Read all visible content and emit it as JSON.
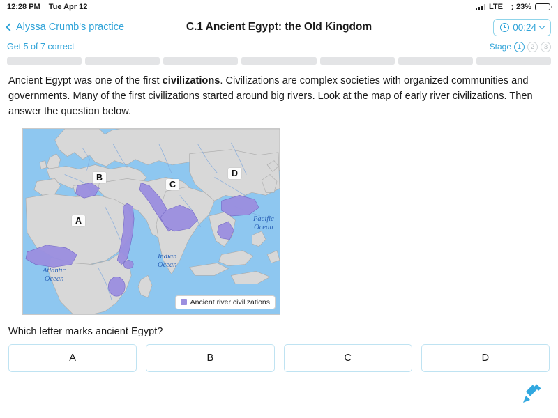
{
  "statusbar": {
    "time": "12:28 PM",
    "date": "Tue Apr 12",
    "network": "LTE",
    "battery_percent": "23%",
    "icons": [
      "signal-bars-icon",
      "moon-icon",
      "battery-icon"
    ]
  },
  "navbar": {
    "back_label": "Alyssa Crumb's practice",
    "back_icon": "chevron-left-icon",
    "title": "C.1 Ancient Egypt: the Old Kingdom",
    "timer": {
      "icon": "clock-icon",
      "value": "00:24",
      "chevron": "chevron-down-icon"
    }
  },
  "progress": {
    "goal_text": "Get 5 of 7 correct",
    "stage_label": "Stage",
    "stages": [
      "1",
      "2",
      "3"
    ],
    "active_stage": "1",
    "segments": 7,
    "filled_segments": 0
  },
  "passage": {
    "part1": "Ancient Egypt was one of the first ",
    "bold": "civilizations",
    "part2": ". Civilizations are complex societies with organized communities and governments. Many of the first civilizations started around big rivers. Look at the map of early river civilizations. Then answer the question below."
  },
  "map": {
    "labels": [
      {
        "id": "A",
        "text": "A"
      },
      {
        "id": "B",
        "text": "B"
      },
      {
        "id": "C",
        "text": "C"
      },
      {
        "id": "D",
        "text": "D"
      }
    ],
    "ocean_labels": [
      {
        "id": "atlantic",
        "line1": "Atlantic",
        "line2": "Ocean"
      },
      {
        "id": "indian",
        "line1": "Indian",
        "line2": "Ocean"
      },
      {
        "id": "pacific",
        "line1": "Pacific",
        "line2": "Ocean"
      }
    ],
    "legend_text": "Ancient river civilizations",
    "colors": {
      "ocean": "#8ec7f0",
      "land": "#d8d8d8",
      "civilization": "#9b8fe0",
      "border": "#c9c9c9"
    }
  },
  "question": {
    "text": "Which letter marks ancient Egypt?",
    "options": [
      "A",
      "B",
      "C",
      "D"
    ]
  },
  "footer": {
    "pencil_icon": "pencil-icon",
    "accent_color": "#2fa3d8"
  }
}
